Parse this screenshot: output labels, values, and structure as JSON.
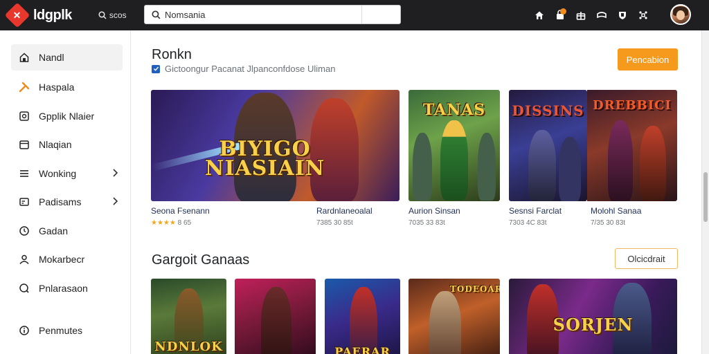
{
  "app": {
    "logo_text": "ldgplk",
    "logo_glyph": "✕",
    "top_link": "scos"
  },
  "search": {
    "value": "Nomsania"
  },
  "sidebar": {
    "items": [
      {
        "label": "Nandl",
        "icon": "home-icon"
      },
      {
        "label": "Haspala",
        "icon": "tools-icon"
      },
      {
        "label": "Gpplik Nlaier",
        "icon": "gamepad-icon"
      },
      {
        "label": "Nlaqian",
        "icon": "folder-icon"
      },
      {
        "label": "Wonking",
        "icon": "list-icon",
        "has_submenu": true
      },
      {
        "label": "Padisams",
        "icon": "card-icon",
        "has_submenu": true
      },
      {
        "label": "Gadan",
        "icon": "clock-icon"
      },
      {
        "label": "Mokarbecr",
        "icon": "user-icon"
      },
      {
        "label": "Pnlarasaon",
        "icon": "search-circle-icon"
      },
      {
        "label": "Penmutes",
        "icon": "info-icon"
      }
    ]
  },
  "section1": {
    "title": "Ronkn",
    "subline": "Gictoongur Pacanat  Jlpanconfdose  Uliman",
    "button": "Pencabion"
  },
  "section2": {
    "title": "Gargoit Ganaas",
    "button": "Olcicdrait"
  },
  "featured": [
    {
      "art_title": "BIYIGO NIASIAIN",
      "name": "Seona Fsenann",
      "stars": "★★★★",
      "sub": "8 65"
    },
    {
      "art_title": "",
      "name": "Rardnlaneoalal",
      "stars": "",
      "sub": "7385 30 85t"
    },
    {
      "art_title": "TANAS",
      "name": "Aurion Sinsan",
      "stars": "",
      "sub": "7035 33 83t"
    },
    {
      "art_title": "DISSINS",
      "name": "Sesnsi Farclat",
      "stars": "",
      "sub": "7303 4C 83t"
    },
    {
      "art_title": "DREBBICI",
      "name": "Molohl Sanaa",
      "stars": "",
      "sub": "7/35 30 83t"
    }
  ],
  "popular": [
    {
      "art_title": "NDNLOK"
    },
    {
      "art_title": ""
    },
    {
      "art_title": "PAERAR"
    },
    {
      "art_title": "TODEOAR"
    },
    {
      "art_title": "SORJEN"
    }
  ],
  "colors": {
    "accent": "#f59a1c",
    "topbar": "#1f1f21",
    "link": "#1e2d55"
  }
}
